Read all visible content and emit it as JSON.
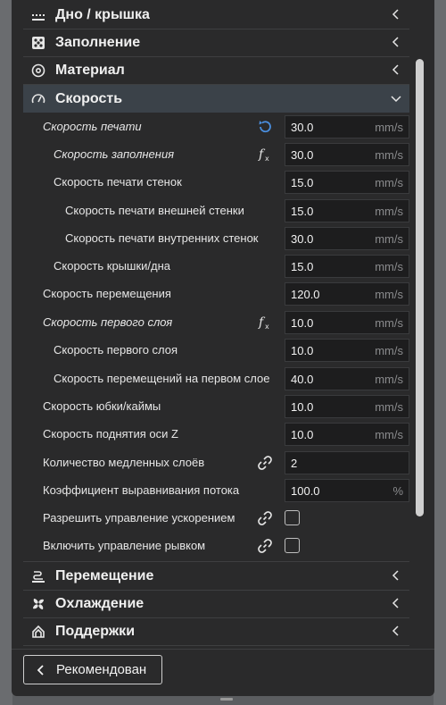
{
  "sections_top": [
    {
      "label": "Дно / крышка",
      "icon": "bottom-top-icon"
    },
    {
      "label": "Заполнение",
      "icon": "infill-icon"
    },
    {
      "label": "Материал",
      "icon": "material-icon"
    }
  ],
  "speed_section": {
    "label": "Скорость",
    "icon": "speed-icon"
  },
  "rows": [
    {
      "label": "Скорость печати",
      "value": "30.0",
      "unit": "mm/s",
      "icon": "reset-icon"
    },
    {
      "label": "Скорость заполнения",
      "value": "30.0",
      "unit": "mm/s",
      "icon": "function-icon"
    },
    {
      "label": "Скорость печати стенок",
      "value": "15.0",
      "unit": "mm/s"
    },
    {
      "label": "Скорость печати внешней стенки",
      "value": "15.0",
      "unit": "mm/s"
    },
    {
      "label": "Скорость печати внутренних стенок",
      "value": "30.0",
      "unit": "mm/s"
    },
    {
      "label": "Скорость крышки/дна",
      "value": "15.0",
      "unit": "mm/s"
    },
    {
      "label": "Скорость перемещения",
      "value": "120.0",
      "unit": "mm/s"
    },
    {
      "label": "Скорость первого слоя",
      "value": "10.0",
      "unit": "mm/s",
      "icon": "function-icon"
    },
    {
      "label": "Скорость первого слоя",
      "value": "10.0",
      "unit": "mm/s"
    },
    {
      "label": "Скорость перемещений на первом слое",
      "value": "40.0",
      "unit": "mm/s"
    },
    {
      "label": "Скорость юбки/каймы",
      "value": "10.0",
      "unit": "mm/s"
    },
    {
      "label": "Скорость поднятия оси Z",
      "value": "10.0",
      "unit": "mm/s"
    },
    {
      "label": "Количество медленных слоёв",
      "value": "2",
      "unit": "",
      "icon": "link-icon"
    },
    {
      "label": "Коэффициент выравнивания потока",
      "value": "100.0",
      "unit": "%"
    },
    {
      "label": "Разрешить управление ускорением",
      "checked": false,
      "icon": "link-icon"
    },
    {
      "label": "Включить управление рывком",
      "checked": false,
      "icon": "link-icon"
    }
  ],
  "sections_bottom": [
    {
      "label": "Перемещение",
      "icon": "travel-icon"
    },
    {
      "label": "Охлаждение",
      "icon": "cooling-icon"
    },
    {
      "label": "Поддержки",
      "icon": "support-icon"
    }
  ],
  "recommended_button": "Рекомендован"
}
